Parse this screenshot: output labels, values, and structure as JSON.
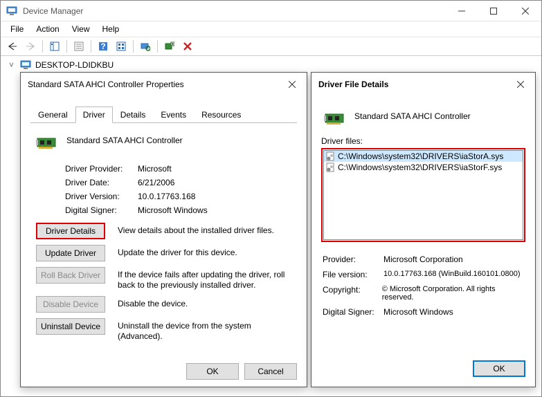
{
  "titlebar": {
    "title": "Device Manager"
  },
  "menubar": {
    "file": "File",
    "action": "Action",
    "view": "View",
    "help": "Help"
  },
  "tree": {
    "root": "DESKTOP-LDIDKBU"
  },
  "props": {
    "title": "Standard SATA AHCI Controller Properties",
    "tabs": {
      "general": "General",
      "driver": "Driver",
      "details": "Details",
      "events": "Events",
      "resources": "Resources"
    },
    "device_name": "Standard SATA AHCI Controller",
    "info": {
      "provider_label": "Driver Provider:",
      "provider_value": "Microsoft",
      "date_label": "Driver Date:",
      "date_value": "6/21/2006",
      "version_label": "Driver Version:",
      "version_value": "10.0.17763.168",
      "signer_label": "Digital Signer:",
      "signer_value": "Microsoft Windows"
    },
    "buttons": {
      "details": "Driver Details",
      "details_desc": "View details about the installed driver files.",
      "update": "Update Driver",
      "update_desc": "Update the driver for this device.",
      "rollback": "Roll Back Driver",
      "rollback_desc": "If the device fails after updating the driver, roll back to the previously installed driver.",
      "disable": "Disable Device",
      "disable_desc": "Disable the device.",
      "uninstall": "Uninstall Device",
      "uninstall_desc": "Uninstall the device from the system (Advanced)."
    },
    "ok": "OK",
    "cancel": "Cancel"
  },
  "dfd": {
    "title": "Driver File Details",
    "device_name": "Standard SATA AHCI Controller",
    "files_label": "Driver files:",
    "files": [
      "C:\\Windows\\system32\\DRIVERS\\iaStorA.sys",
      "C:\\Windows\\system32\\DRIVERS\\iaStorF.sys"
    ],
    "info": {
      "provider_label": "Provider:",
      "provider_value": "Microsoft Corporation",
      "version_label": "File version:",
      "version_value": "10.0.17763.168 (WinBuild.160101.0800)",
      "copyright_label": "Copyright:",
      "copyright_value": "© Microsoft Corporation. All rights reserved.",
      "signer_label": "Digital Signer:",
      "signer_value": "Microsoft Windows"
    },
    "ok": "OK"
  }
}
